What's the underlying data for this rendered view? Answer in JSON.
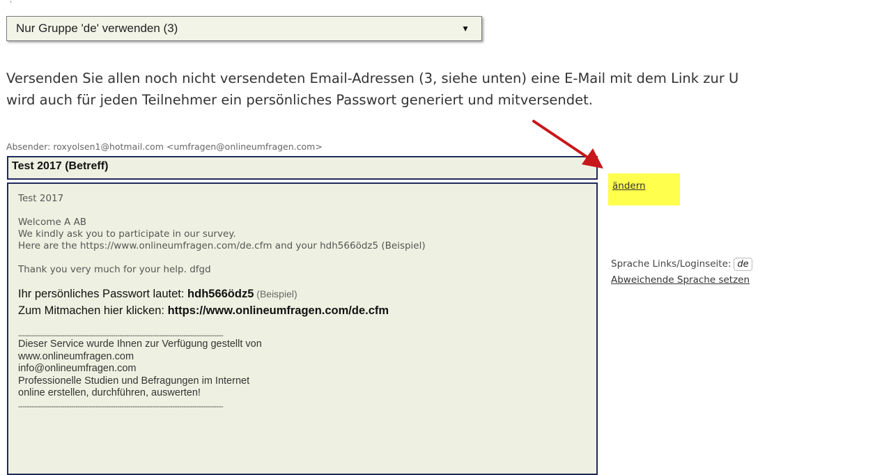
{
  "group_select": {
    "value": "Nur Gruppe 'de' verwenden (3)",
    "arrow": "▼"
  },
  "intro": {
    "line1": "Versenden Sie allen noch nicht versendeten Email-Adressen (3, siehe unten) eine E-Mail mit dem Link zur U",
    "line2": "wird auch für jeden Teilnehmer ein persönliches Passwort generiert und mitversendet."
  },
  "sender": "Absender: roxyolsen1@hotmail.com <umfragen@onlineumfragen.com>",
  "subject": "Test 2017 (Betreff)",
  "email": {
    "title": "Test 2017",
    "welcome": "Welcome A AB",
    "ask": "We kindly ask you to participate in our survey.",
    "here": "Here are the https://www.onlineumfragen.com/de.cfm and your hdh566ödz5 (Beispiel)",
    "thanks": "Thank you very much for your help. dfgd",
    "pw_label": "Ihr persönliches Passwort lautet: ",
    "pw_value": "hdh566ödz5",
    "pw_example": " (Beispiel)",
    "click_label": "Zum Mitmachen hier klicken: ",
    "click_url": "https://www.onlineumfragen.com/de.cfm",
    "dashes": "---------------------------------------------------------------------------------------------",
    "footer1": "Dieser Service wurde Ihnen zur Verfügung gestellt von",
    "footer2": "www.onlineumfragen.com",
    "footer3": "info@onlineumfragen.com",
    "footer4": "Professionelle Studien und Befragungen im Internet",
    "footer5": "online erstellen, durchführen, auswerten!"
  },
  "side": {
    "change_link": "ändern",
    "lang_label": "Sprache Links/Loginseite:",
    "lang_value": "de",
    "lang_link": "Abweichende Sprache setzen"
  },
  "colors": {
    "highlight": "#ffff4d",
    "annotation_arrow": "#c8171b",
    "box_fill": "#eef1e1",
    "box_border": "#1e2a5a"
  }
}
